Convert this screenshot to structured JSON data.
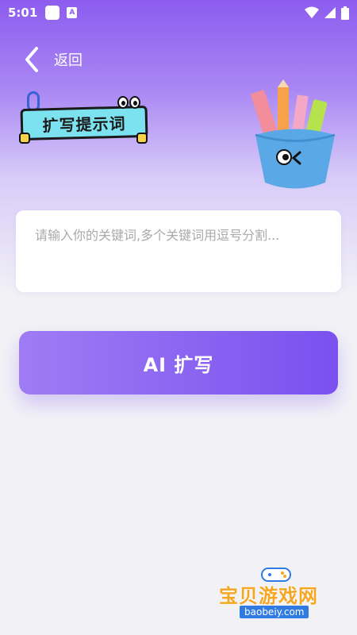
{
  "status_bar": {
    "time": "5:01",
    "notification_badge": "A"
  },
  "nav": {
    "back_label": "返回"
  },
  "header": {
    "sticker_title": "扩写提示词"
  },
  "input": {
    "placeholder": "请输入你的关键词,多个关键词用逗号分割..."
  },
  "actions": {
    "expand_label": "AI 扩写"
  },
  "watermark": {
    "title": "宝贝游戏网",
    "url": "baobeiy.com"
  },
  "colors": {
    "accent": "#7a50ef",
    "accent_light": "#9f7cf4",
    "sticker_bg": "#7de2f0",
    "watermark_text": "#f5a623"
  },
  "icons": {
    "back": "chevron-left-icon",
    "wifi": "wifi-icon",
    "signal": "signal-icon",
    "battery": "battery-icon",
    "illustration": "pencil-cup-icon"
  }
}
